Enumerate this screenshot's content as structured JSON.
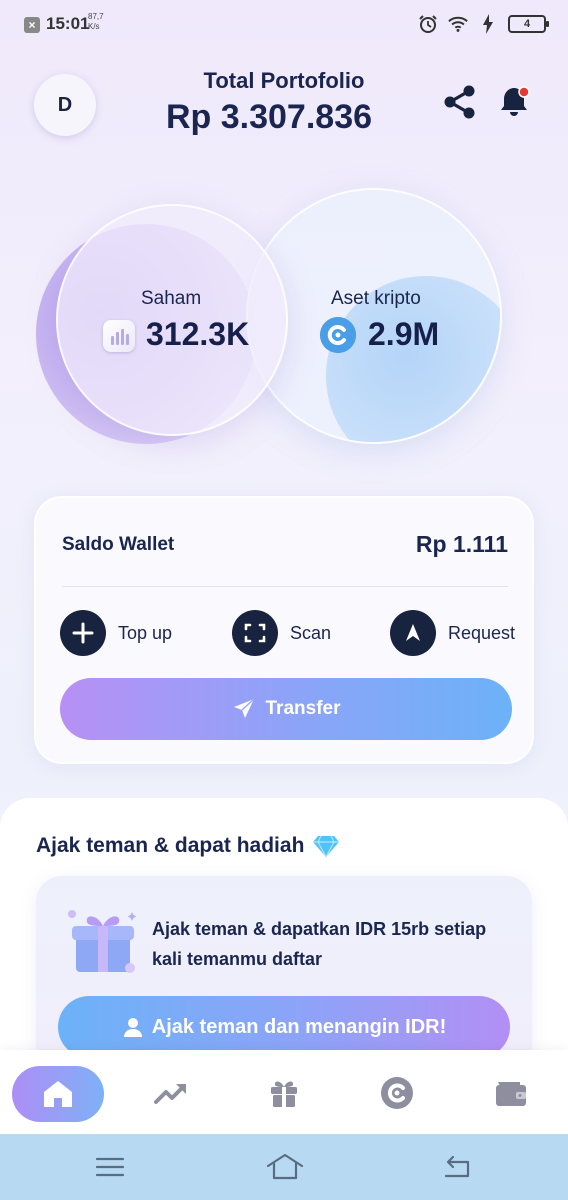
{
  "status_bar": {
    "time": "15:01",
    "net_speed_top": "87,7",
    "net_speed_bottom": "K/s",
    "battery": "4",
    "icons": [
      "close-notification-icon",
      "alarm-icon",
      "wifi-icon",
      "charging-icon",
      "battery-icon"
    ]
  },
  "header": {
    "avatar_initial": "D",
    "total_label": "Total Portofolio",
    "total_value": "Rp 3.307.836",
    "share_icon": "share-icon",
    "bell_icon": "bell-icon",
    "notification_dot_color": "#e53935"
  },
  "assets": {
    "stock": {
      "label": "Saham",
      "value": "312.3K",
      "icon": "chart-bar-icon"
    },
    "crypto": {
      "label": "Aset kripto",
      "value": "2.9M",
      "icon": "crypto-coin-icon"
    }
  },
  "wallet": {
    "title": "Saldo Wallet",
    "amount": "Rp 1.111",
    "actions": [
      {
        "label": "Top up",
        "icon": "plus-icon"
      },
      {
        "label": "Scan",
        "icon": "scan-icon"
      },
      {
        "label": "Request",
        "icon": "request-arrow-icon"
      }
    ],
    "transfer_label": "Transfer",
    "transfer_icon": "send-icon"
  },
  "referral": {
    "section_title": "Ajak teman & dapat hadiah",
    "section_icon": "diamond-icon",
    "card_text": "Ajak teman & dapatkan IDR 15rb setiap kali temanmu daftar",
    "button_label": "Ajak teman dan menangin IDR!",
    "button_icon": "user-icon",
    "art_icon": "gift-box-icon"
  },
  "tab_bar": {
    "items": [
      {
        "name": "home",
        "icon": "home-icon",
        "active": true
      },
      {
        "name": "market",
        "icon": "trending-up-icon",
        "active": false
      },
      {
        "name": "rewards",
        "icon": "gift-icon",
        "active": false
      },
      {
        "name": "crypto",
        "icon": "crypto-coin-icon",
        "active": false
      },
      {
        "name": "wallet",
        "icon": "wallet-icon",
        "active": false
      }
    ]
  },
  "system_nav": {
    "icons": [
      "menu-icon",
      "home-outline-icon",
      "back-icon"
    ]
  },
  "colors": {
    "primary_text": "#1b2650",
    "action_circle": "#17233f",
    "gradient_purple": "#b790f5",
    "gradient_blue": "#6cb2f8",
    "system_nav_bg": "#b7d9f2"
  }
}
